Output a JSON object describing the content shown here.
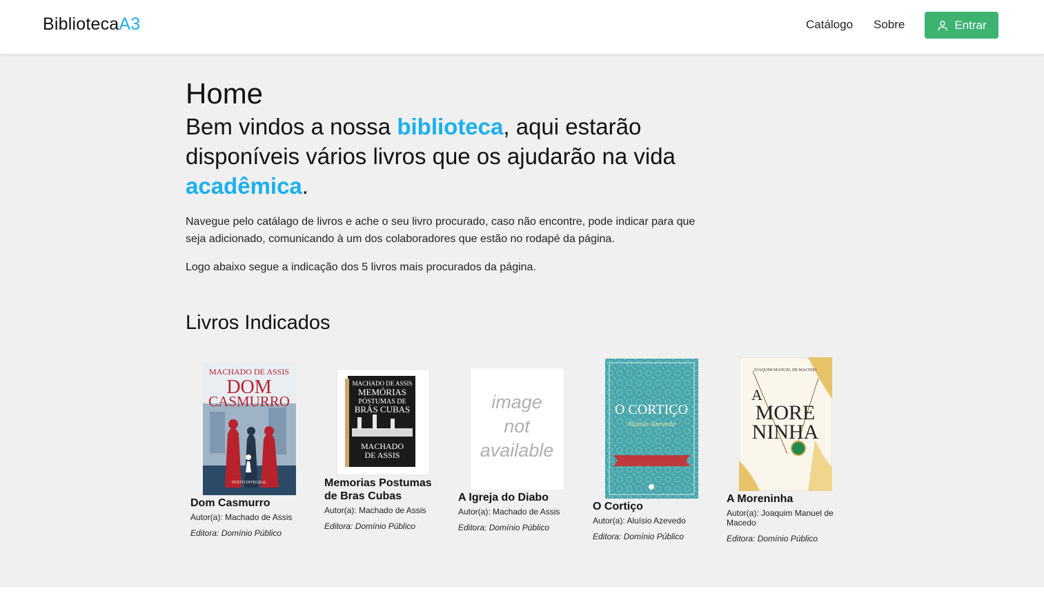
{
  "header": {
    "brand_main": "Biblioteca",
    "brand_accent": "A3",
    "nav": {
      "catalogo": "Catálogo",
      "sobre": "Sobre"
    },
    "login_label": "Entrar"
  },
  "main": {
    "title": "Home",
    "welcome": {
      "part1": "Bem vindos a nossa ",
      "hl1": "biblioteca",
      "part2": ", aqui estarão disponíveis vários livros que os ajudarão na vida ",
      "hl2": "acadêmica",
      "part3": "."
    },
    "paragraph1": "Navegue pelo catálago de livros e ache o seu livro procurado, caso não encontre, pode indicar para que seja adicionado, comunicando à um dos colaboradores que estão no rodapé da página.",
    "paragraph2": "Logo abaixo segue a indicação dos 5 livros mais procurados da página."
  },
  "books_section": {
    "title": "Livros Indicados",
    "books": [
      {
        "title": "Dom Casmurro",
        "author": "Autor(a): Machado de Assis",
        "publisher": "Editora: Domínio Público",
        "cover": {
          "top": "MACHADO DE ASSIS",
          "line1": "DOM",
          "line2": "CASMURRO",
          "bottom": "TEXTO INTEGRAL"
        }
      },
      {
        "title": "Memorias Postumas de Bras Cubas",
        "author": "Autor(a): Machado de Assis",
        "publisher": "Editora: Domínio Público",
        "cover": {
          "top": "MACHADO DE ASSIS",
          "line1": "MEMÓRIAS",
          "line2": "PÓSTUMAS DE",
          "line3": "BRÁS CUBAS",
          "bottom1": "MACHADO",
          "bottom2": "DE ASSIS"
        }
      },
      {
        "title": "A Igreja do Diabo",
        "author": "Autor(a): Machado de Assis",
        "publisher": "Editora: Domínio Público",
        "cover": {
          "line1": "image",
          "line2": "not",
          "line3": "available"
        }
      },
      {
        "title": "O Cortiço",
        "author": "Autor(a): Aluísio Azevedo",
        "publisher": "Editora: Domínio Público",
        "cover": {
          "title": "O CORTIÇO",
          "author": "Aluísio Azevedo"
        }
      },
      {
        "title": "A Moreninha",
        "author": "Autor(a): Joaquim Manuel de Macedo",
        "publisher": "Editora: Domínio Público",
        "cover": {
          "top": "JOAQUIM MANUEL DE MACEDO",
          "line1": "A",
          "line2": "MORE",
          "line3": "NINHA"
        }
      }
    ]
  },
  "colors": {
    "accent": "#1ab0f0",
    "button": "#3cb371",
    "background": "#f0f0f0"
  }
}
